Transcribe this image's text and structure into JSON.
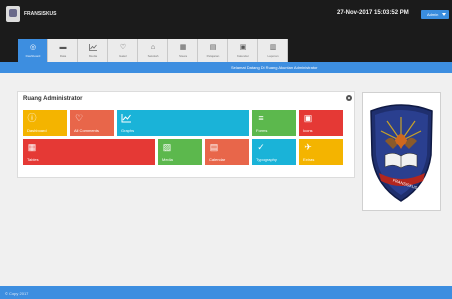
{
  "header": {
    "brand": "FRANSISKUS",
    "datetime": "27-Nov-2017 15:03:52 PM",
    "user_button": "Admin"
  },
  "tabs": [
    {
      "label": "Dashboard",
      "icon": "dashboard-icon",
      "active": true
    },
    {
      "label": "Data",
      "icon": "database-icon",
      "active": false
    },
    {
      "label": "Media",
      "icon": "chart-icon",
      "active": false
    },
    {
      "label": "Galeri",
      "icon": "heart-icon",
      "active": false
    },
    {
      "label": "Sekolah",
      "icon": "building-icon",
      "active": false
    },
    {
      "label": "Siswa",
      "icon": "table-icon",
      "active": false
    },
    {
      "label": "Pelajaran",
      "icon": "book-icon",
      "active": false
    },
    {
      "label": "Kalender",
      "icon": "calendar-icon",
      "active": false
    },
    {
      "label": "Laporan",
      "icon": "report-icon",
      "active": false
    }
  ],
  "welcome": "Selamat Datang Di Ruang Akuntan Administrator",
  "panel": {
    "title": "Ruang Administrator",
    "tiles": [
      {
        "label": "Dashboard",
        "icon": "info-icon",
        "color": "#f4b400"
      },
      {
        "label": "All Comments",
        "icon": "heart-icon",
        "color": "#e8664a"
      },
      {
        "label": "Graphs",
        "icon": "chart-icon",
        "color": "#1ab3d8"
      },
      {
        "label": "Forms",
        "icon": "list-icon",
        "color": "#5cb84d"
      },
      {
        "label": "Icons",
        "icon": "briefcase-icon",
        "color": "#e53935"
      },
      {
        "label": "Tables",
        "icon": "table-icon",
        "color": "#e53935"
      },
      {
        "label": "Media",
        "icon": "image-icon",
        "color": "#5cb84d"
      },
      {
        "label": "Calendar",
        "icon": "calendar-icon",
        "color": "#e8664a"
      },
      {
        "label": "Typography",
        "icon": "abc-check-icon",
        "color": "#1ab3d8"
      },
      {
        "label": "Extras",
        "icon": "plane-icon",
        "color": "#f4b400"
      }
    ]
  },
  "crest": {
    "text": "FRANSISKUS"
  },
  "footer": "© Copy 2017"
}
